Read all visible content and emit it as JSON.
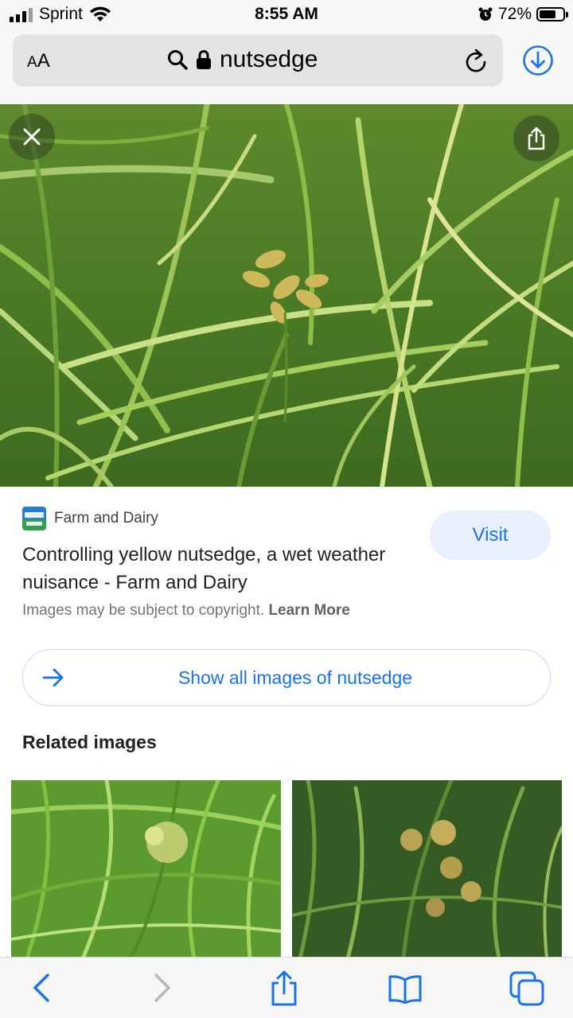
{
  "status_bar": {
    "carrier": "Sprint",
    "time": "8:55 AM",
    "battery_percent": "72%",
    "battery_level": 0.72
  },
  "url_bar": {
    "aa_label_big": "A",
    "aa_label_small": "A",
    "url": "nutsedge"
  },
  "result": {
    "source": "Farm and Dairy",
    "title": "Controlling yellow nutsedge, a wet weather nuisance - Farm and Dairy",
    "visit_label": "Visit",
    "copyright_text": "Images may be subject to copyright.",
    "learn_more": "Learn More"
  },
  "show_all_label": "Show all images of nutsedge",
  "related": {
    "title": "Related images"
  },
  "colors": {
    "accent": "#1a73e8",
    "toolbar_icon": "#1a73e8"
  },
  "icons": [
    "search-icon",
    "lock-icon",
    "reload-icon",
    "download-icon",
    "close-icon",
    "share-icon",
    "arrow-right-icon",
    "back-icon",
    "forward-icon",
    "bookmarks-icon",
    "tabs-icon"
  ]
}
